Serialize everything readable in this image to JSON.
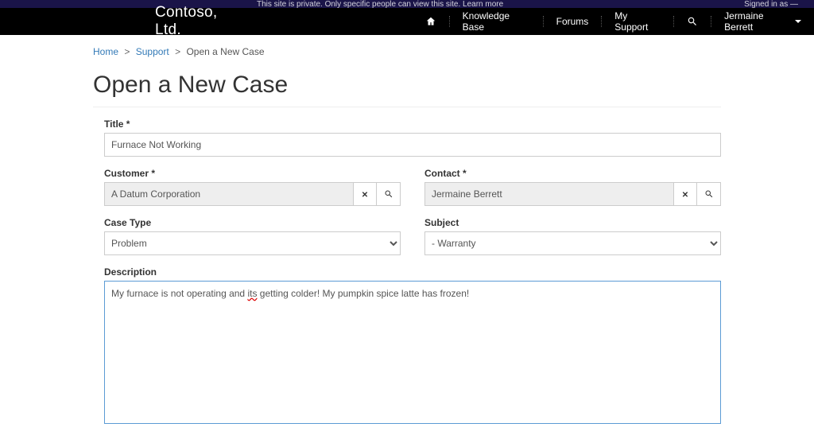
{
  "topbar": {
    "center": "This site is private. Only specific people can view this site. Learn more",
    "right": "Signed in as —"
  },
  "brand": "Contoso, Ltd.",
  "nav": {
    "knowledge": "Knowledge Base",
    "forums": "Forums",
    "support": "My Support",
    "user": "Jermaine Berrett"
  },
  "breadcrumb": {
    "home": "Home",
    "support": "Support",
    "current": "Open a New Case"
  },
  "page_title": "Open a New Case",
  "form": {
    "title_label": "Title *",
    "title_value": "Furnace Not Working",
    "customer_label": "Customer *",
    "customer_value": "A Datum Corporation",
    "contact_label": "Contact *",
    "contact_value": "Jermaine Berrett",
    "casetype_label": "Case Type",
    "casetype_value": "Problem",
    "subject_label": "Subject",
    "subject_value": " - Warranty",
    "description_label": "Description",
    "description_pre": "My furnace is not operating and ",
    "description_err": "its",
    "description_post": " getting colder!  My pumpkin spice latte has frozen!"
  }
}
